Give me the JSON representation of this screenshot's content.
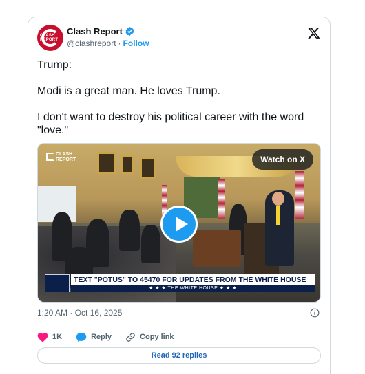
{
  "author": {
    "display_name": "Clash Report",
    "handle": "@clashreport",
    "separator": "·",
    "follow_label": "Follow",
    "avatar_text": "CLASH REPORT"
  },
  "tweet": {
    "paragraphs": [
      "Trump:",
      "Modi is a great man. He loves Trump.",
      "I don't want to destroy his political career with the word \"love.\""
    ]
  },
  "media": {
    "badge_text": "CLASH REPORT",
    "watch_label": "Watch on X",
    "lower_third_text": "TEXT \"POTUS\" TO 45470 FOR UPDATES FROM THE WHITE HOUSE",
    "lower_third_sub": "★ ★ ★  THE WHITE HOUSE  ★ ★ ★"
  },
  "meta": {
    "timestamp": "1:20 AM · Oct 16, 2025"
  },
  "actions": {
    "likes": "1K",
    "reply_label": "Reply",
    "copy_label": "Copy link"
  },
  "replies_button": "Read 92 replies",
  "colors": {
    "brand_red": "#c8102e",
    "link_blue": "#1d9bf0",
    "like_pink": "#f91880",
    "reply_blue": "#1d66b8"
  }
}
